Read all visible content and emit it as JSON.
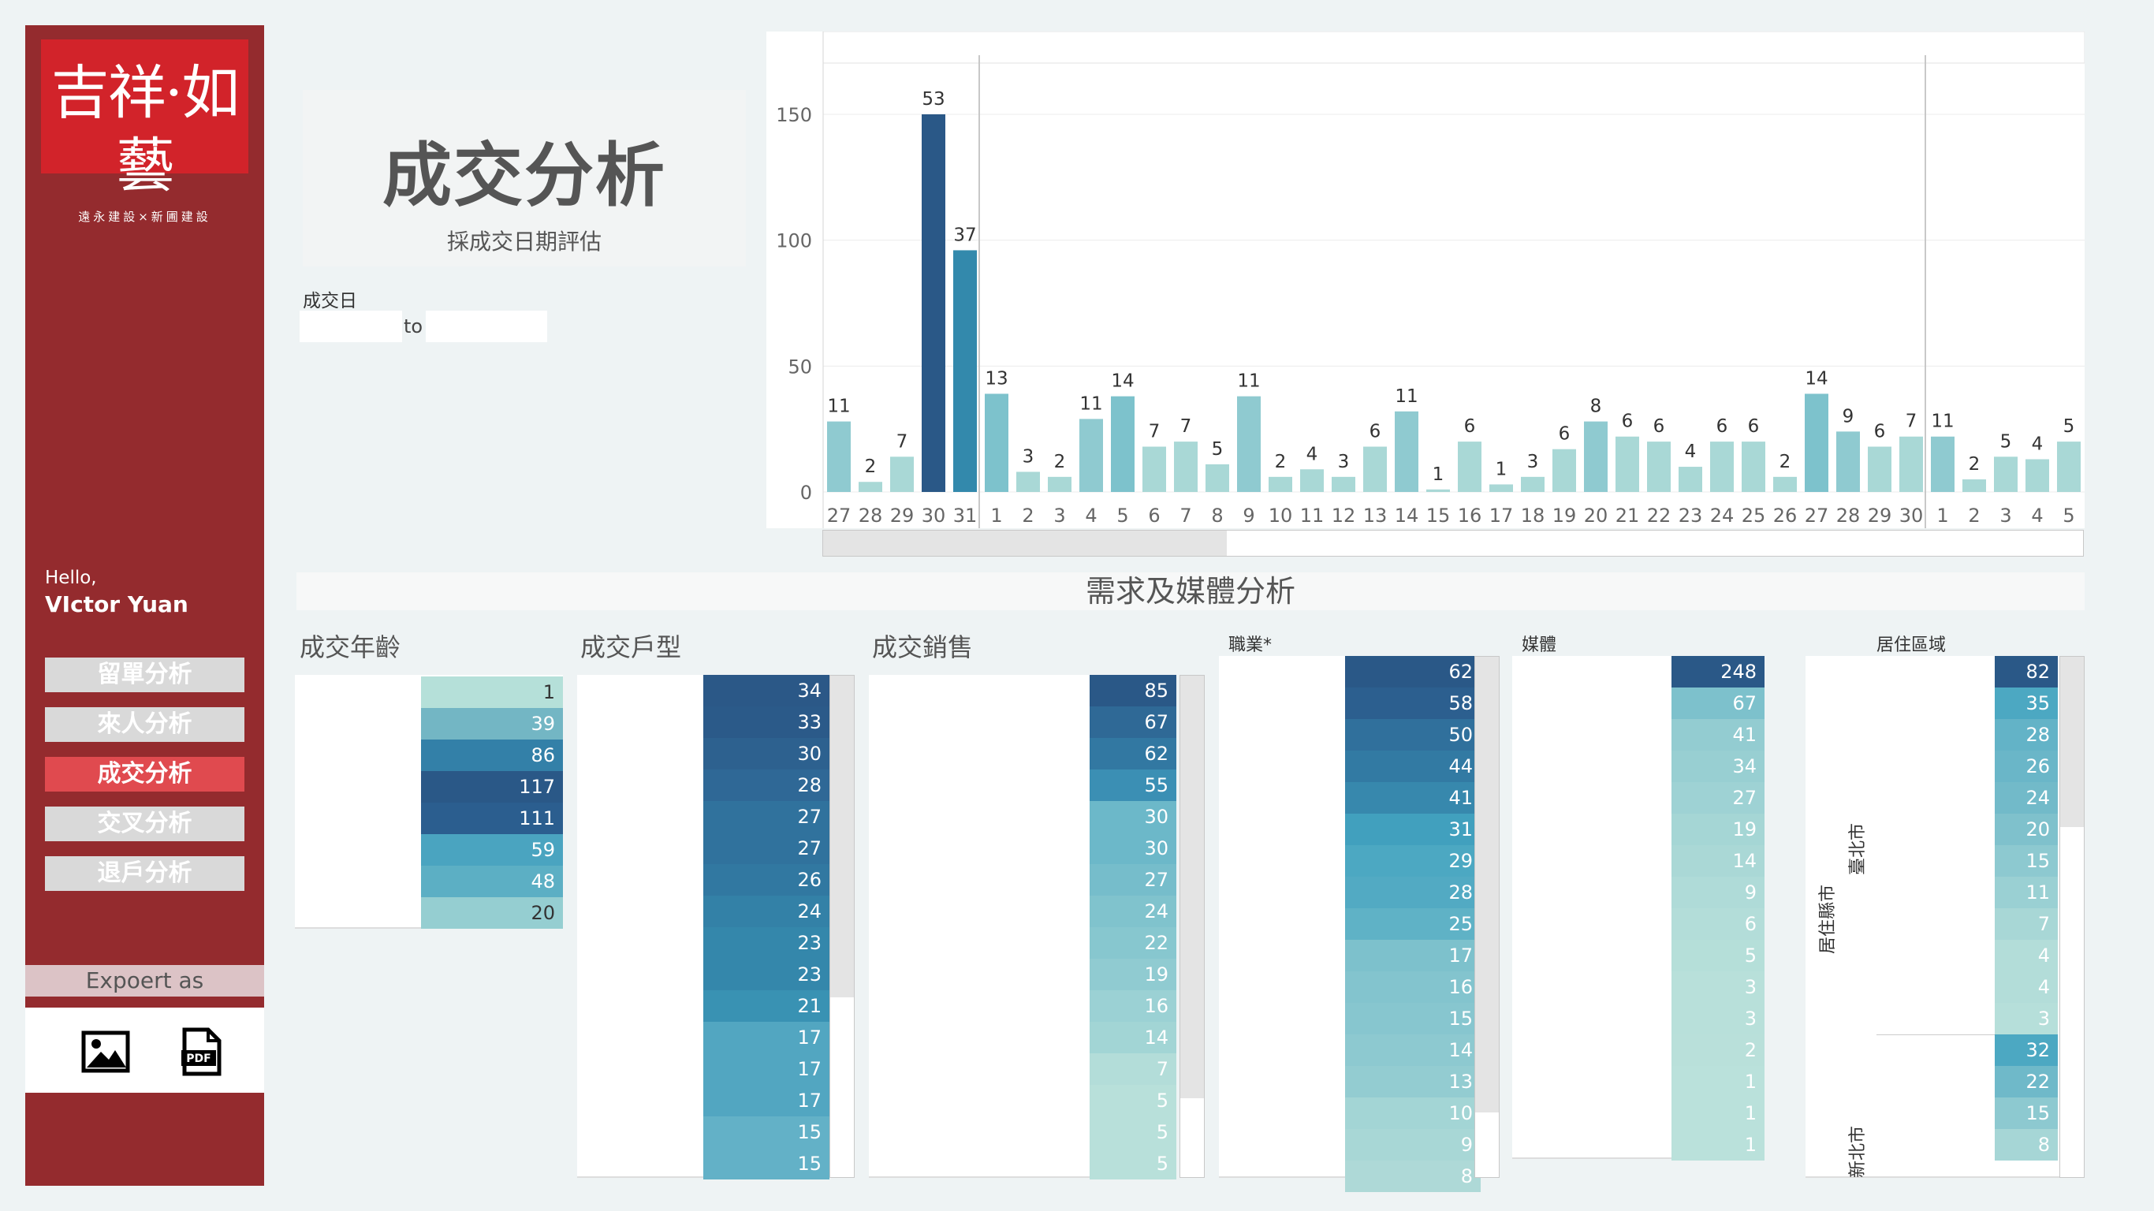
{
  "sidebar": {
    "logo_main": "吉祥·如藝",
    "logo_sub": "遠永建設×新圃建設",
    "greeting": "Hello,",
    "user_name": "VIctor Yuan",
    "nav": [
      "留單分析",
      "來人分析",
      "成交分析",
      "交叉分析",
      "退戶分析"
    ],
    "active_nav": "成交分析",
    "export_label": "Expoert as",
    "export_icons": [
      "image-icon",
      "pdf-icon"
    ]
  },
  "header": {
    "title": "成交分析",
    "subtitle": "採成交日期評估",
    "filter_label": "成交日",
    "date_from": "",
    "date_to": "",
    "to_label": "to"
  },
  "chart_data": {
    "type": "bar",
    "title": "",
    "xlabel": "",
    "ylabel": "",
    "ylim": [
      0,
      170
    ],
    "yticks": [
      0,
      50,
      100,
      150
    ],
    "categories": [
      "27",
      "28",
      "29",
      "30",
      "31",
      "1",
      "2",
      "3",
      "4",
      "5",
      "6",
      "7",
      "8",
      "9",
      "10",
      "11",
      "12",
      "13",
      "14",
      "15",
      "16",
      "17",
      "18",
      "19",
      "20",
      "21",
      "22",
      "23",
      "24",
      "25",
      "26",
      "27",
      "28",
      "29",
      "30",
      "1",
      "2",
      "3",
      "4",
      "5"
    ],
    "values": [
      11,
      2,
      7,
      53,
      37,
      13,
      3,
      2,
      11,
      14,
      7,
      7,
      5,
      11,
      2,
      4,
      3,
      6,
      11,
      1,
      6,
      1,
      3,
      6,
      8,
      6,
      6,
      4,
      6,
      6,
      2,
      14,
      9,
      6,
      7,
      11,
      2,
      5,
      4,
      5
    ],
    "bar_heights_scale": [
      28,
      4,
      14,
      150,
      96,
      39,
      8,
      6,
      29,
      38,
      18,
      20,
      11,
      38,
      6,
      9,
      6,
      18,
      32,
      1,
      20,
      3,
      6,
      17,
      28,
      22,
      20,
      10,
      20,
      20,
      6,
      39,
      24,
      18,
      22,
      22,
      5,
      14,
      13,
      20
    ],
    "data_labels": [
      "11",
      "2",
      "7",
      "53",
      "37",
      "13",
      "3",
      "2",
      "11",
      "14",
      "7",
      "7",
      "5",
      "11",
      "2",
      "4",
      "3",
      "6",
      "11",
      "1",
      "6",
      "1",
      "3",
      "6",
      "8",
      "6",
      "6",
      "4",
      "6",
      "6",
      "2",
      "14",
      "9",
      "6",
      "7",
      "11",
      "2",
      "5",
      "4",
      "5"
    ],
    "grid": true
  },
  "section": {
    "title": "需求及媒體分析"
  },
  "panels": {
    "age": {
      "title": "成交年齡",
      "values": [
        "1",
        "39",
        "86",
        "117",
        "111",
        "59",
        "48",
        "20"
      ],
      "colors": [
        "#b5e0d9",
        "#73b6c4",
        "#3380a8",
        "#2a5887",
        "#2b5e8f",
        "#4aa4c0",
        "#5cafc4",
        "#95ced1"
      ]
    },
    "unit_type": {
      "title": "成交戶型",
      "values": [
        "34",
        "33",
        "30",
        "28",
        "27",
        "27",
        "26",
        "24",
        "23",
        "23",
        "21",
        "17",
        "17",
        "17",
        "15",
        "15"
      ],
      "colors": [
        "#2b5887",
        "#2b5a89",
        "#2d618f",
        "#2f6896",
        "#30729d",
        "#30729d",
        "#3178a1",
        "#3381a7",
        "#3487ab",
        "#3487ab",
        "#3992b3",
        "#52a6c1",
        "#52a6c1",
        "#52a6c1",
        "#63b1c7",
        "#63b1c7"
      ]
    },
    "sales": {
      "title": "成交銷售",
      "values": [
        "85",
        "67",
        "62",
        "55",
        "30",
        "30",
        "27",
        "24",
        "22",
        "19",
        "16",
        "14",
        "7",
        "5",
        "5",
        "5"
      ],
      "colors": [
        "#2a5887",
        "#2f6996",
        "#3278a2",
        "#3b8fb4",
        "#6cb8c9",
        "#6cb8c9",
        "#76bdcb",
        "#80c3cd",
        "#87c7cf",
        "#90cbd1",
        "#9bd1d4",
        "#a2d5d5",
        "#b3ddd9",
        "#b8e0da",
        "#b8e0da",
        "#b8e0da"
      ]
    },
    "occupation": {
      "title": "職業*",
      "values": [
        "62",
        "58",
        "50",
        "44",
        "41",
        "31",
        "29",
        "28",
        "25",
        "17",
        "16",
        "15",
        "14",
        "13",
        "10",
        "9",
        "8"
      ],
      "colors": [
        "#2a5887",
        "#2c5f8f",
        "#30709c",
        "#327aa3",
        "#3788ad",
        "#41a0be",
        "#4ca8c2",
        "#52aac3",
        "#5fb2c6",
        "#7dc1cc",
        "#83c4ce",
        "#87c6cf",
        "#8dc9d0",
        "#93ccd1",
        "#a3d5d5",
        "#a8d7d6",
        "#aed9d7"
      ]
    },
    "media": {
      "title": "媒體",
      "values": [
        "248",
        "67",
        "41",
        "34",
        "27",
        "19",
        "14",
        "9",
        "6",
        "5",
        "3",
        "3",
        "2",
        "1",
        "1",
        "1"
      ],
      "colors": [
        "#2a5887",
        "#7dc1cc",
        "#93ccd1",
        "#98cfd2",
        "#9ed2d4",
        "#a5d6d5",
        "#aad8d6",
        "#afdbd8",
        "#b3ddd9",
        "#b5dfd9",
        "#b8e0da",
        "#b8e0da",
        "#b9e0da",
        "#bae1db",
        "#bae1db",
        "#bae1db"
      ]
    },
    "residence": {
      "title": "居住區域",
      "axis_label": "居住縣市",
      "group1": "臺北市",
      "group2": "新北市",
      "values": [
        "82",
        "35",
        "28",
        "26",
        "24",
        "20",
        "15",
        "11",
        "7",
        "4",
        "4",
        "3",
        "32",
        "22",
        "15",
        "8"
      ],
      "colors": [
        "#2a5887",
        "#4ca8c2",
        "#63b3c7",
        "#6ab6c8",
        "#72bac9",
        "#7fc1cc",
        "#8dc9d0",
        "#9ad0d3",
        "#a8d7d6",
        "#b3ddd9",
        "#b3ddd9",
        "#b6dfda",
        "#4ca8c2",
        "#6fb9c9",
        "#8dc9d0",
        "#a6d6d6"
      ]
    }
  }
}
